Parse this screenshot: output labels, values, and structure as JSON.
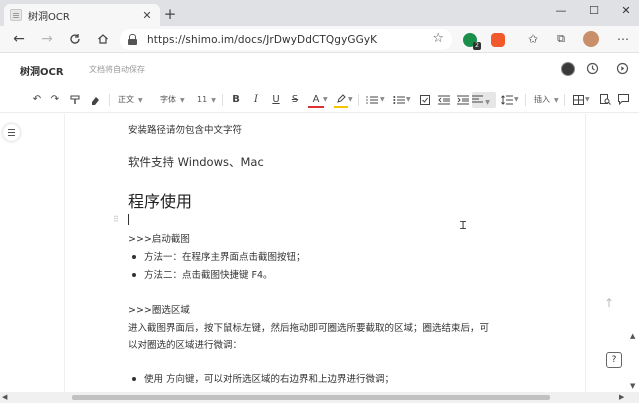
{
  "browser": {
    "tab_title": "树洞OCR",
    "tab_close": "✕",
    "new_tab": "+",
    "window_controls": [
      "—",
      "☐",
      "✕"
    ],
    "url": "https://shimo.im/docs/JrDwyDdCTQgyGGyK",
    "icons": [
      "back-arrow-icon",
      "forward-arrow-icon",
      "refresh-icon",
      "home-icon",
      "lock-icon",
      "star-icon",
      "collections-icon",
      "favorites-icon",
      "profile-avatar",
      "more-icon"
    ],
    "ext_badge": "2"
  },
  "header": {
    "doc_title": "树洞OCR",
    "status": "文档将自动保存"
  },
  "toolbar": {
    "undo": "↶",
    "redo": "↷",
    "format_painter": "⌐",
    "clear_format": "⌫",
    "paragraph_style": "正文",
    "font_family": "字体",
    "font_size": "11",
    "bold": "B",
    "italic": "I",
    "underline": "U",
    "strikethrough": "S",
    "font_color": "A",
    "insert": "插入"
  },
  "document": {
    "line1": "安装路径请勿包含中文字符",
    "line2": "软件支持 Windows、Mac",
    "heading": "程序使用",
    "section1_title": ">>>启动截图",
    "section1_items": [
      "方法一：在程序主界面点击截图按钮；",
      "方法二：点击截图快捷键 F4。"
    ],
    "section2_title": ">>>圈选区域",
    "section2_para1": "进入截图界面后，按下鼠标左键，然后拖动即可圈选所要截取的区域；圈选结束后，可",
    "section2_para2": "以对圈选的区域进行微调：",
    "section2_items": [
      "使用 方向键，可以对所选区域的右边界和上边界进行微调；"
    ]
  },
  "floating": {
    "help": "?",
    "scroll_top": "↑"
  },
  "colors": {
    "chrome_bg": "#dfe1e5",
    "addr_bg": "#f7f7f7",
    "text": "#333333",
    "muted": "#999999"
  }
}
